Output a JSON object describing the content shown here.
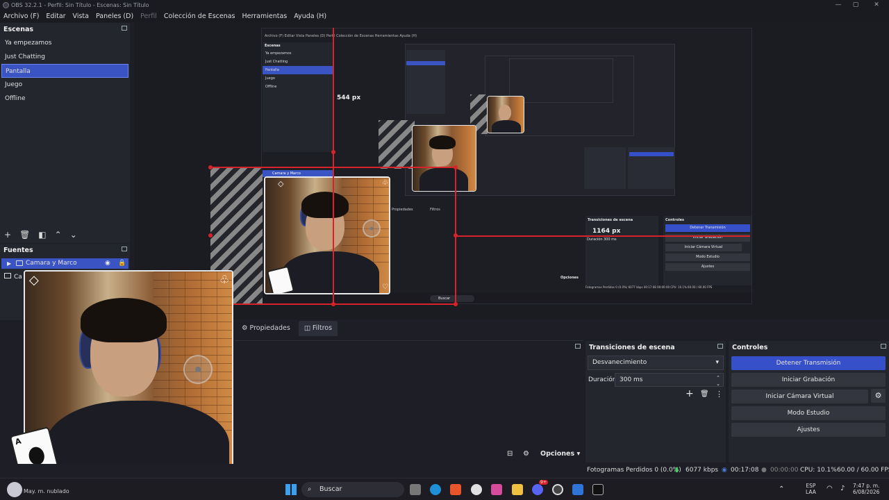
{
  "window": {
    "title": "OBS 32.2.1 - Perfil: Sin Título - Escenas: Sin Título",
    "minimize": "—",
    "maximize": "▢",
    "close": "✕"
  },
  "menu": [
    "Archivo (F)",
    "Editar",
    "Vista",
    "Paneles (D)",
    "Perfil",
    "Colección de Escenas",
    "Herramientas",
    "Ayuda (H)"
  ],
  "scenes": {
    "header": "Escenas",
    "items": [
      "Ya empezamos",
      "Just Chatting",
      "Pantalla",
      "Juego",
      "Offline"
    ],
    "selected_index": 2
  },
  "sources": {
    "header": "Fuentes",
    "items": [
      "Camara y Marco",
      "Ca"
    ]
  },
  "preview": {
    "height_label": "544 px",
    "width_label": "1164 px",
    "inner_menu": "Archivo (F)   Editar   Vista   Paneles (D)   Perfil   Colección de Escenas   Herramientas   Ayuda (H)",
    "inner_scenes": [
      "Ya empezamos",
      "Just Chatting",
      "Pantalla",
      "Juego",
      "Offline"
    ],
    "inner_controls": [
      "Detener Transmisión",
      "Iniciar Grabación",
      "Iniciar Cámara Virtual",
      "Modo Estudio",
      "Ajustes"
    ],
    "inner_tabs": [
      "Propiedades",
      "Filtros"
    ],
    "inner_source": "Camara y Marco",
    "inner_transition": "Transiciones de escena",
    "inner_controls_header": "Controles",
    "inner_duration_label": "Duración",
    "inner_duration": "300 ms",
    "inner_options": "Opciones",
    "inner_search": "Buscar",
    "inner_status": "Fotogramas Perdidos 0 (0.0%)   6077 kbps   00:17:08   00:00:00   CPU: 10.1%   60.00 / 60.00 FPS"
  },
  "tabs": [
    "Propiedades",
    "Filtros"
  ],
  "options_label": "Opciones",
  "transitions": {
    "header": "Transiciones de escena",
    "selected": "Desvanecimiento",
    "duration_label": "Duración",
    "duration": "300 ms"
  },
  "controls": {
    "header": "Controles",
    "buttons": [
      "Detener Transmisión",
      "Iniciar Grabación",
      "Iniciar Cámara Virtual",
      "Modo Estudio",
      "Ajustes"
    ]
  },
  "status": {
    "dropped": "Fotogramas Perdidos 0 (0.0%)",
    "bitrate": "6077 kbps",
    "stream_time": "00:17:08",
    "rec_time": "00:00:00",
    "cpu": "CPU: 10.1%",
    "fps": "60.00 / 60.00 FPS"
  },
  "taskbar": {
    "search": "Buscar",
    "weather": "May. m. nublado",
    "lang": "ESP",
    "lang2": "LAA",
    "time": "7:47 p. m.",
    "date": "6/08/2026",
    "discord_badge": "9+"
  },
  "colors": {
    "accent": "#3550c8",
    "selection_red": "#d8232a",
    "background": "#1e1f26"
  }
}
